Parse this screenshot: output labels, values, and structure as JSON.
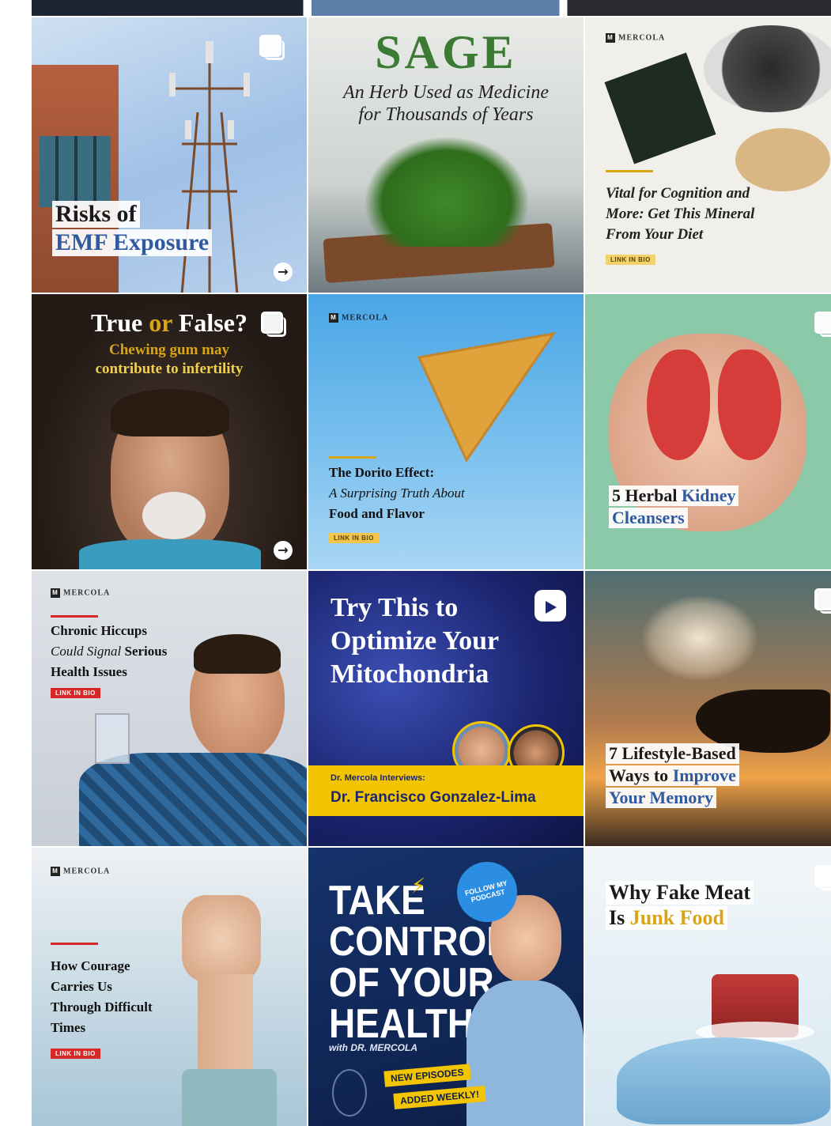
{
  "tiles": {
    "emf": {
      "line1": "Risks of",
      "line2": "EMF Exposure"
    },
    "sage": {
      "title": "SAGE",
      "subtitle_1": "An Herb Used as Medicine",
      "subtitle_2": "for Thousands of Years"
    },
    "iodine": {
      "logo": "MERCOLA",
      "line1": "Vital for Cognition and",
      "line2": "More: Get This Mineral",
      "line3": "From Your Diet",
      "button": "LINK IN BIO"
    },
    "gum": {
      "title_a": "True ",
      "title_b": "or",
      "title_c": " False?",
      "sub1": "Chewing gum may",
      "sub2": "contribute to infertility"
    },
    "dorito": {
      "logo": "MERCOLA",
      "line1": "The Dorito Effect:",
      "line2": "A Surprising Truth About",
      "line3": "Food and Flavor",
      "button": "LINK IN BIO"
    },
    "kidney": {
      "line1a": "5 Herbal ",
      "line1b": "Kidney",
      "line2": "Cleansers"
    },
    "hiccups": {
      "logo": "MERCOLA",
      "line1": "Chronic Hiccups",
      "line2a": "Could Signal",
      "line2b": " Serious",
      "line3": "Health Issues",
      "button": "LINK IN BIO"
    },
    "mito": {
      "line1": "Try This to",
      "line2": "Optimize Your",
      "line3": "Mitochondria",
      "interview_label": "Dr. Mercola Interviews:",
      "guest": "Dr. Francisco Gonzalez-Lima"
    },
    "memory": {
      "line1": "7 Lifestyle-Based",
      "line2a": "Ways to ",
      "line2b": "Improve",
      "line3": "Your Memory"
    },
    "courage": {
      "logo": "MERCOLA",
      "line1": "How Courage",
      "line2": "Carries Us",
      "line3": "Through Difficult",
      "line4": "Times",
      "button": "LINK IN BIO"
    },
    "podcast": {
      "t1": "TAKE",
      "t2": "CONTROL",
      "t3": "OF YOUR",
      "t4": "HEALTH",
      "with": "with DR. MERCOLA",
      "badge": "FOLLOW MY PODCAST",
      "banner1": "NEW EPISODES",
      "banner2": "ADDED WEEKLY!"
    },
    "fakemeat": {
      "line1": "Why Fake Meat",
      "line2a": "Is ",
      "line2b": "Junk Food"
    }
  },
  "colors": {
    "accent_gold": "#d9a514",
    "accent_red": "#d62828",
    "navy": "#0f2a5c",
    "blue_text": "#2f5aa0"
  },
  "icons": [
    "multiple-images-icon",
    "arrow-right-icon",
    "reels-icon",
    "microphone-icon",
    "lightning-icon"
  ]
}
